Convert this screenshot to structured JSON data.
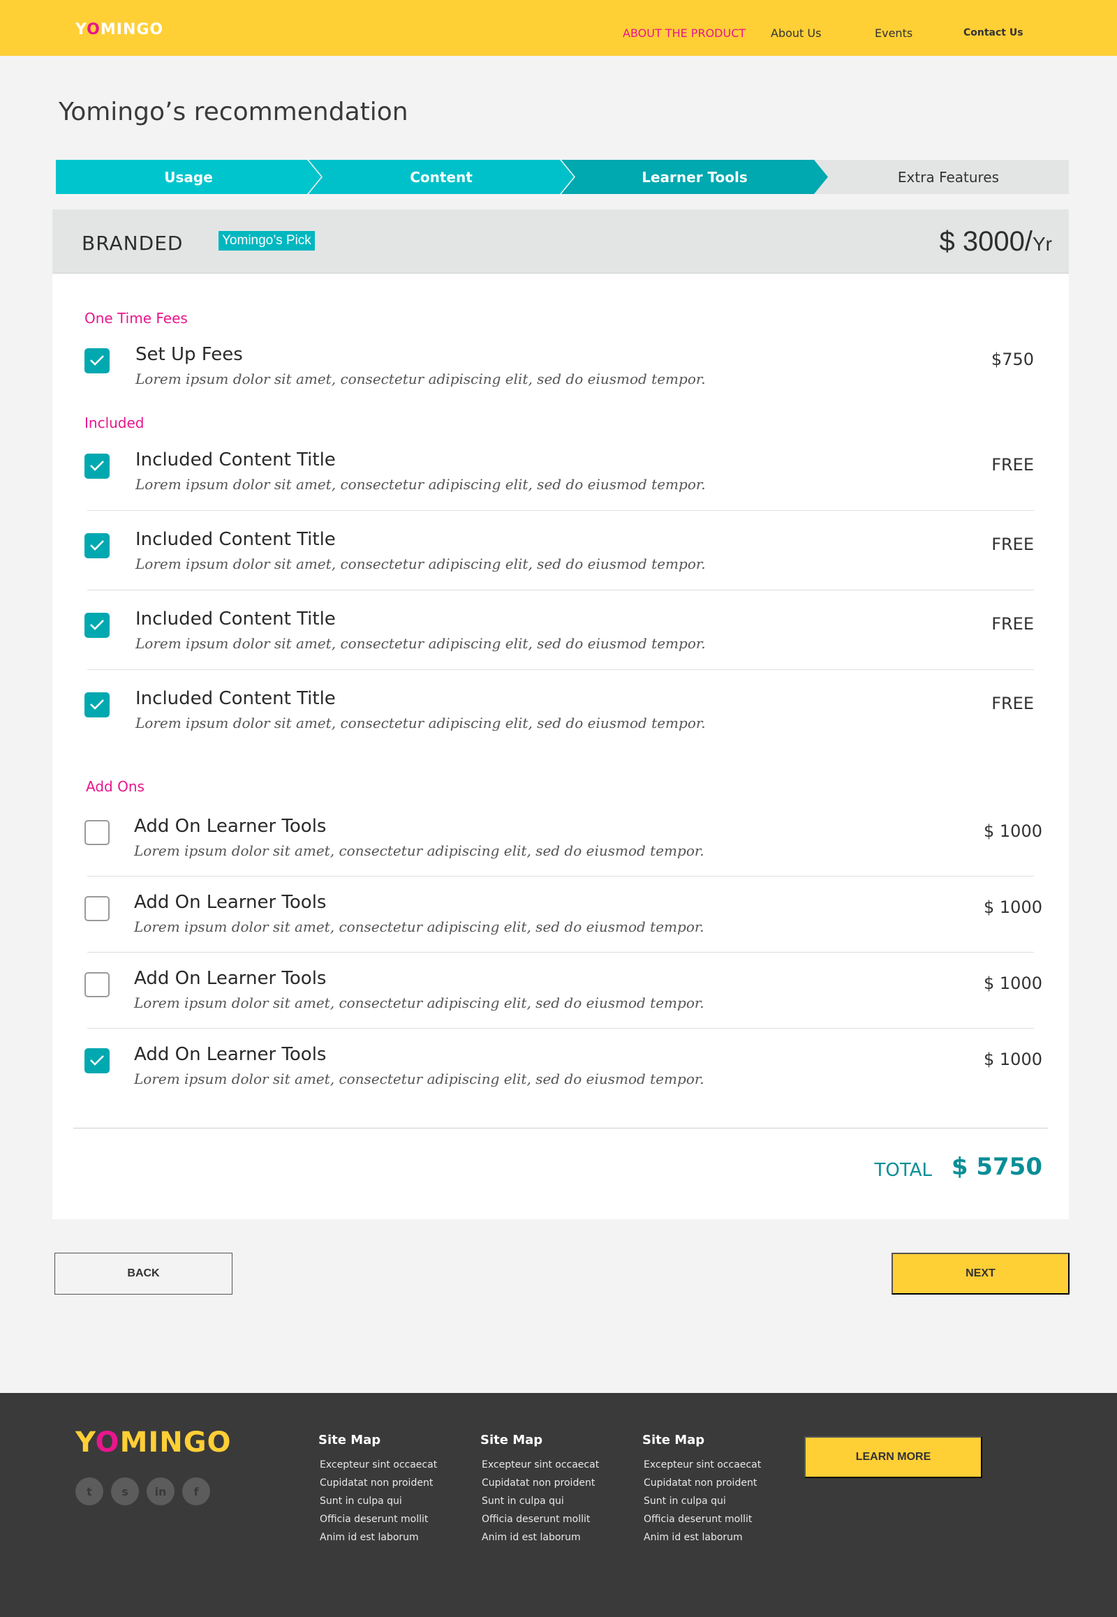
{
  "brand": {
    "logo_y": "Y",
    "logo_o": "O",
    "logo_rest": "MINGO",
    "accent": "#e8168c",
    "primary": "#ffcf36",
    "teal": "#00a8b0"
  },
  "nav": {
    "items": [
      {
        "label": "ABOUT THE PRODUCT"
      },
      {
        "label": "About Us"
      },
      {
        "label": "Events"
      },
      {
        "label": "Contact Us"
      }
    ]
  },
  "page": {
    "title": "Yomingo’s recommendation"
  },
  "stepper": {
    "steps": [
      {
        "label": "Usage"
      },
      {
        "label": "Content"
      },
      {
        "label": "Learner Tools"
      },
      {
        "label": "Extra Features"
      }
    ]
  },
  "plan": {
    "name": "BRANDED",
    "badge": "Yomingo’s Pick",
    "price": "$ 3000/",
    "price_unit": "Yr"
  },
  "sections": {
    "one_time": {
      "label": "One Time Fees",
      "items": [
        {
          "title": "Set Up Fees",
          "desc": "Lorem ipsum dolor sit amet, consectetur adipiscing elit, sed do eiusmod tempor.",
          "price": "$750",
          "checked": true
        }
      ]
    },
    "included": {
      "label": "Included",
      "items": [
        {
          "title": "Included Content Title",
          "desc": "Lorem ipsum dolor sit amet, consectetur adipiscing elit, sed do eiusmod tempor.",
          "price": "FREE",
          "checked": true
        },
        {
          "title": "Included Content Title",
          "desc": "Lorem ipsum dolor sit amet, consectetur adipiscing elit, sed do eiusmod tempor.",
          "price": "FREE",
          "checked": true
        },
        {
          "title": "Included Content Title",
          "desc": "Lorem ipsum dolor sit amet, consectetur adipiscing elit, sed do eiusmod tempor.",
          "price": "FREE",
          "checked": true
        },
        {
          "title": "Included Content Title",
          "desc": "Lorem ipsum dolor sit amet, consectetur adipiscing elit, sed do eiusmod tempor.",
          "price": "FREE",
          "checked": true
        }
      ]
    },
    "addons": {
      "label": "Add Ons",
      "items": [
        {
          "title": "Add On Learner Tools",
          "desc": "Lorem ipsum dolor sit amet, consectetur adipiscing elit, sed do eiusmod tempor.",
          "price": "$ 1000",
          "checked": false
        },
        {
          "title": "Add On Learner Tools",
          "desc": "Lorem ipsum dolor sit amet, consectetur adipiscing elit, sed do eiusmod tempor.",
          "price": "$ 1000",
          "checked": false
        },
        {
          "title": "Add On Learner Tools",
          "desc": "Lorem ipsum dolor sit amet, consectetur adipiscing elit, sed do eiusmod tempor.",
          "price": "$ 1000",
          "checked": false
        },
        {
          "title": "Add On Learner Tools",
          "desc": "Lorem ipsum dolor sit amet, consectetur adipiscing elit, sed do eiusmod tempor.",
          "price": "$ 1000",
          "checked": true
        }
      ]
    }
  },
  "total": {
    "label": "TOTAL",
    "value": "$ 5750"
  },
  "actions": {
    "back": "BACK",
    "next": "NEXT"
  },
  "footer": {
    "socials": [
      {
        "icon": "twitter-icon",
        "glyph": "t"
      },
      {
        "icon": "snapchat-icon",
        "glyph": "s"
      },
      {
        "icon": "linkedin-icon",
        "glyph": "in"
      },
      {
        "icon": "facebook-icon",
        "glyph": "f"
      }
    ],
    "columns": [
      {
        "title": "Site Map",
        "links": [
          "Excepteur sint occaecat",
          "Cupidatat non proident",
          "Sunt in culpa qui",
          "Officia deserunt mollit",
          "Anim id est laborum"
        ]
      },
      {
        "title": "Site Map",
        "links": [
          "Excepteur sint occaecat",
          "Cupidatat non proident",
          "Sunt in culpa qui",
          "Officia deserunt mollit",
          "Anim id est laborum"
        ]
      },
      {
        "title": "Site Map",
        "links": [
          "Excepteur sint occaecat",
          "Cupidatat non proident",
          "Sunt in culpa qui",
          "Officia deserunt mollit",
          "Anim id est laborum"
        ]
      }
    ],
    "cta": "LEARN MORE"
  }
}
